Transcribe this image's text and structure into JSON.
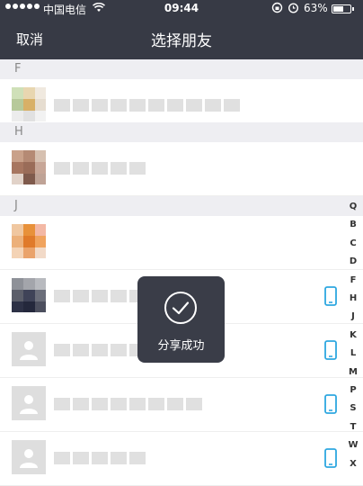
{
  "status_bar": {
    "carrier": "中国电信",
    "time": "09:44",
    "battery": "63%",
    "battery_level": 0.63,
    "icons": [
      "signal-dots-icon",
      "wifi-icon",
      "rotation-lock-icon",
      "alarm-icon",
      "battery-icon"
    ]
  },
  "nav": {
    "cancel_label": "取消",
    "title": "选择朋友"
  },
  "sections": [
    {
      "letter": "F"
    },
    {
      "letter": "H"
    },
    {
      "letter": "J"
    }
  ],
  "index_bar": [
    "Q",
    "B",
    "C",
    "D",
    "F",
    "H",
    "J",
    "K",
    "L",
    "M",
    "P",
    "S",
    "T",
    "W",
    "X"
  ],
  "toast": {
    "text": "分享成功",
    "icon": "checkmark-circle-icon"
  },
  "colors": {
    "header_bg": "#373a45",
    "section_bg": "#eeeef2",
    "phone_icon": "#2ea7e0",
    "toast_bg": "#3a3d48"
  }
}
